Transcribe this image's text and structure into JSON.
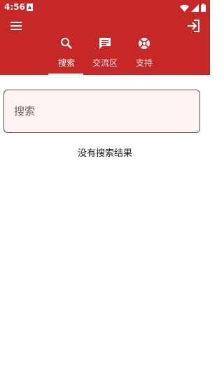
{
  "status_bar": {
    "time": "4:56",
    "icons": [
      "notification-icon",
      "wifi-icon",
      "signal-icon",
      "battery-icon"
    ]
  },
  "app_bar": {
    "menu_icon": "menu-icon",
    "login_icon": "login-icon"
  },
  "tabs": [
    {
      "label": "搜索",
      "icon": "search-icon",
      "active": true
    },
    {
      "label": "交流区",
      "icon": "chat-icon",
      "active": false
    },
    {
      "label": "支持",
      "icon": "support-icon",
      "active": false
    }
  ],
  "search": {
    "placeholder": "搜索",
    "value": ""
  },
  "results": {
    "empty_message": "没有搜索结果"
  },
  "colors": {
    "primary": "#c62828",
    "search_background": "#fdf3f3",
    "text": "#222222"
  }
}
